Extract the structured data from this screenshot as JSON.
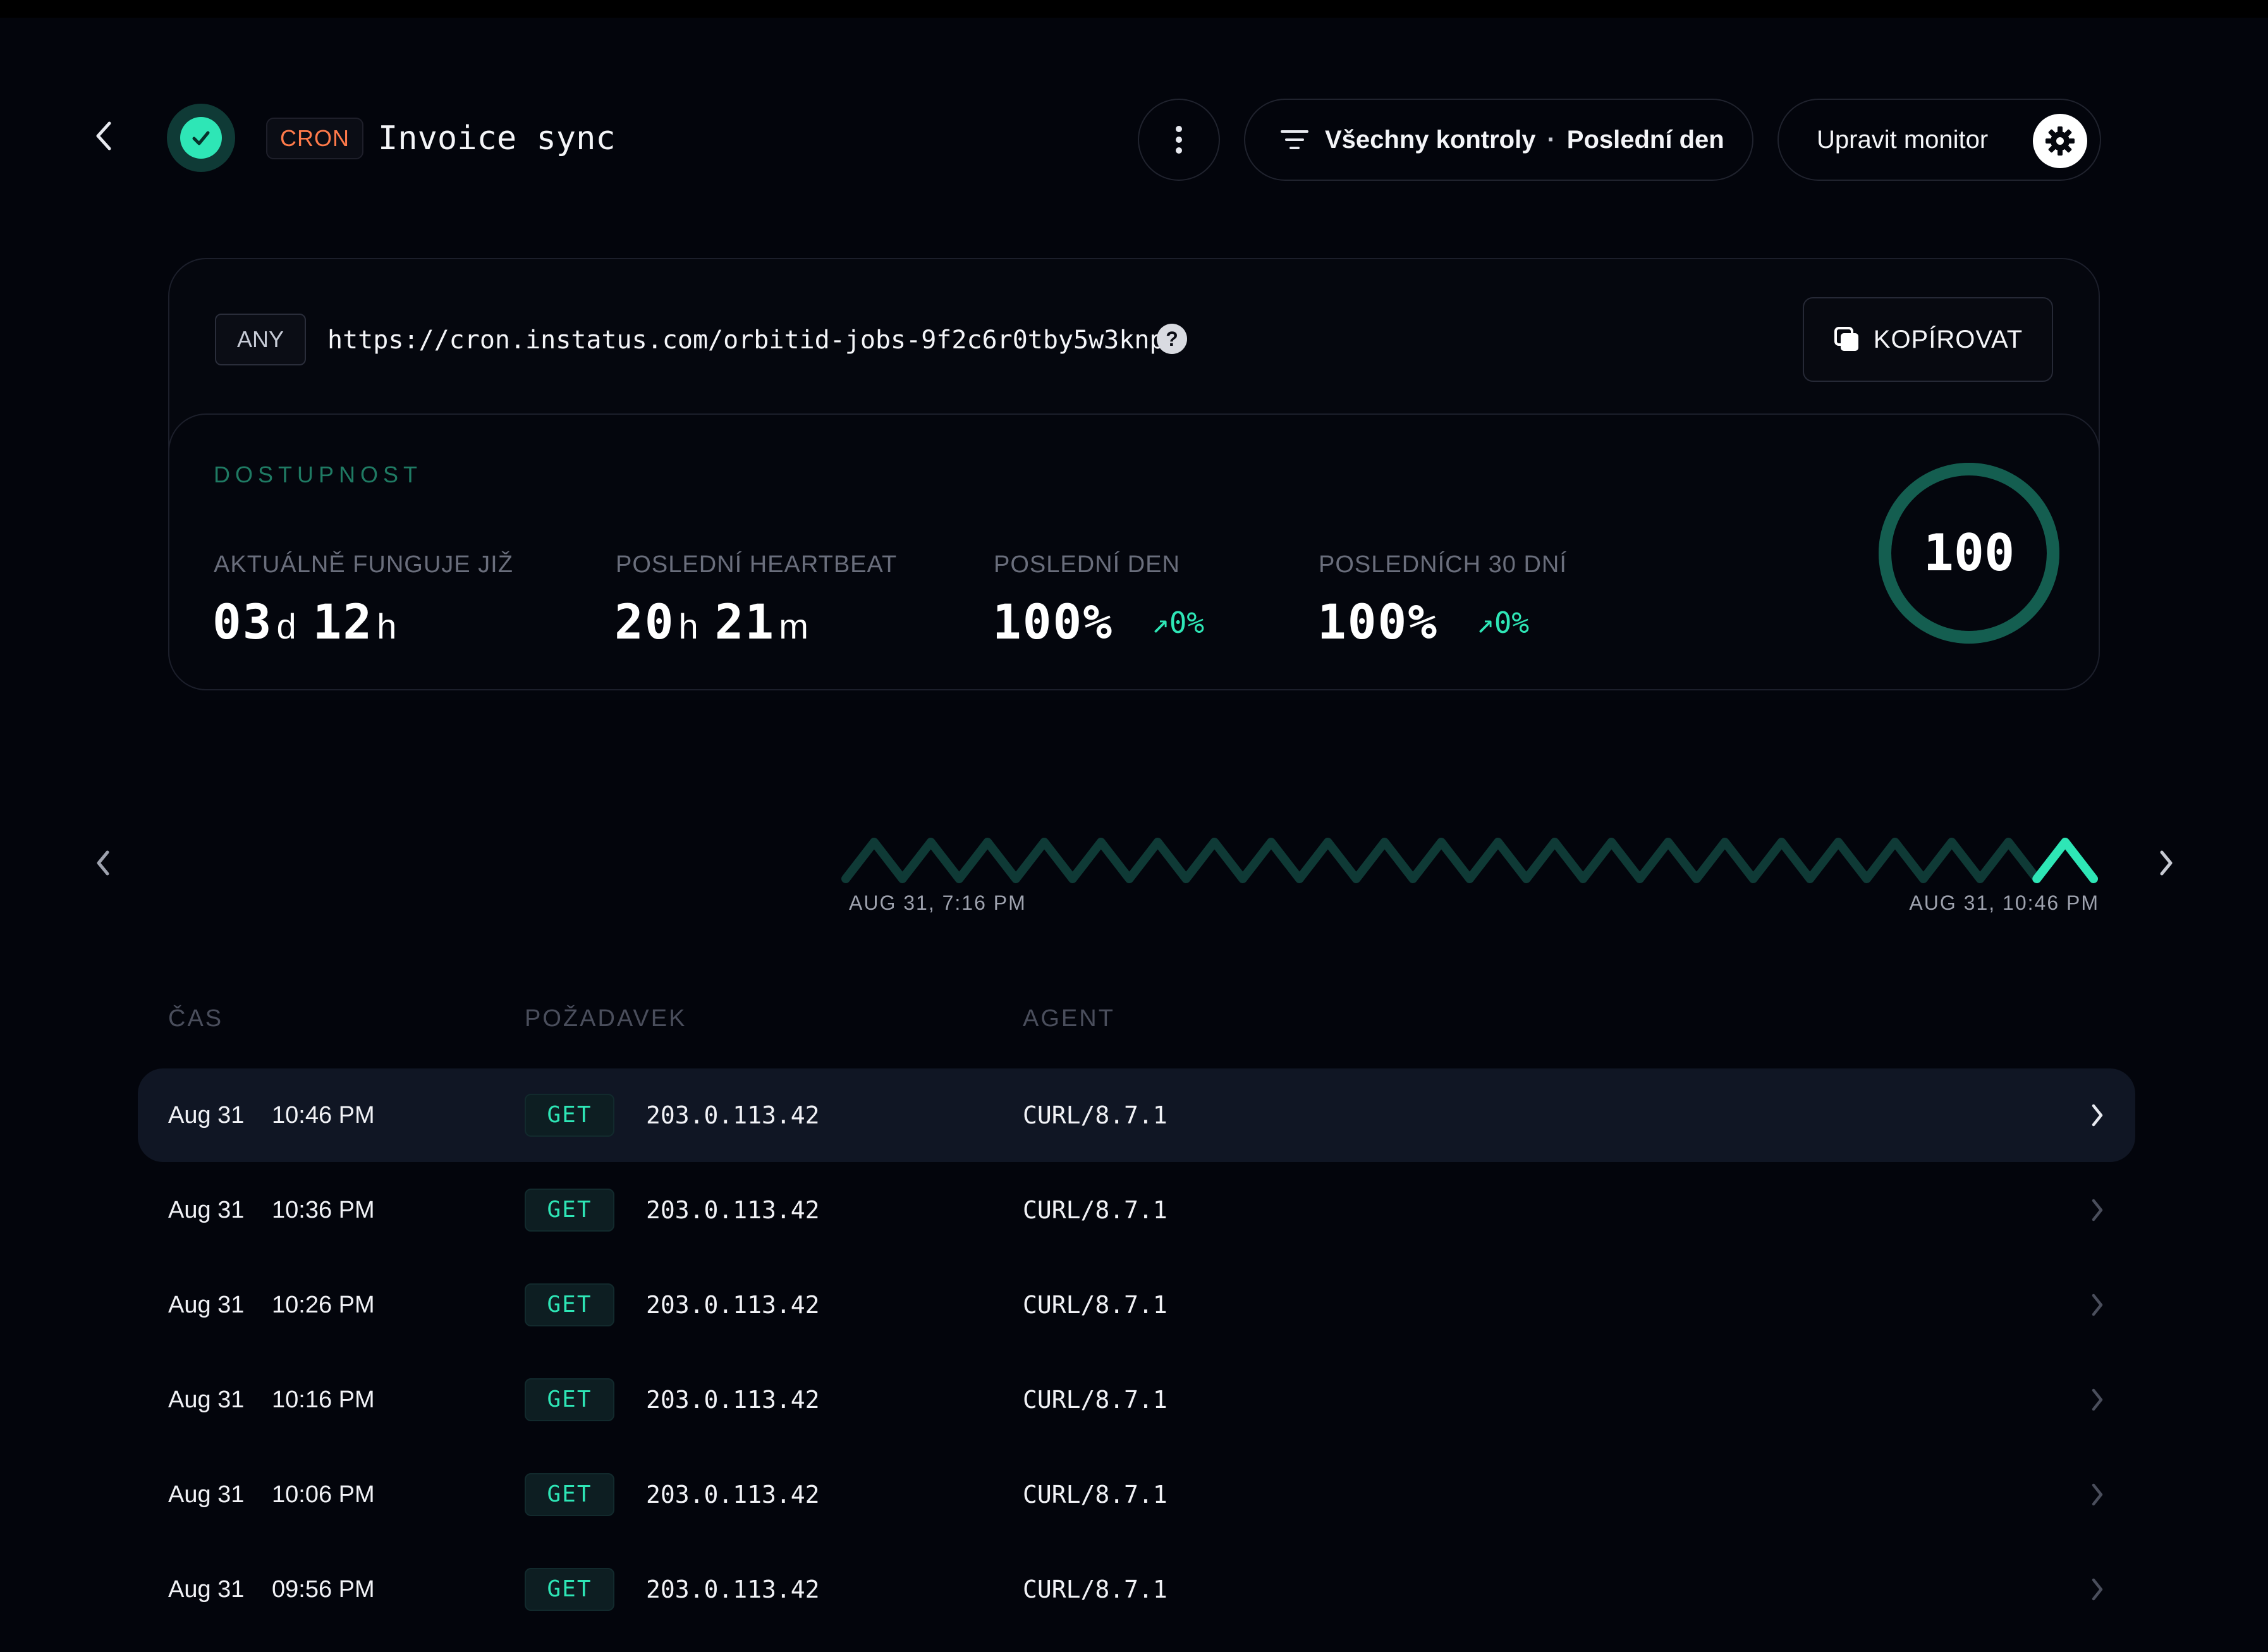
{
  "header": {
    "type_badge": "CRON",
    "title": "Invoice sync",
    "filter_label": "Všechny kontroly",
    "filter_separator": "·",
    "filter_period": "Poslední den",
    "edit_label": "Upravit monitor"
  },
  "endpoint": {
    "method": "ANY",
    "url": "https://cron.instatus.com/orbitid-jobs-9f2c6r0tby5w3knp",
    "help_glyph": "?",
    "copy_label": "KOPÍROVAT"
  },
  "availability": {
    "section_title": "DOSTUPNOST",
    "stats": [
      {
        "label": "AKTUÁLNĚ FUNGUJE JIŽ",
        "v1": "03",
        "u1": "d",
        "v2": "12",
        "u2": "h"
      },
      {
        "label": "POSLEDNÍ HEARTBEAT",
        "v1": "20",
        "u1": "h",
        "v2": "21",
        "u2": "m"
      },
      {
        "label": "POSLEDNÍ DEN",
        "value": "100%",
        "delta": "0%"
      },
      {
        "label": "POSLEDNÍCH 30 DNÍ",
        "value": "100%",
        "delta": "0%"
      }
    ],
    "score": "100",
    "score_fraction": 1.0,
    "accent_color": "#2ee6b6"
  },
  "timeline": {
    "start_label": "AUG 31, 7:16 PM",
    "end_label": "AUG 31, 10:46 PM",
    "peaks": 22,
    "highlight_last": true
  },
  "table": {
    "headers": {
      "time": "ČAS",
      "request": "POŽADAVEK",
      "agent": "AGENT"
    },
    "rows": [
      {
        "date": "Aug 31",
        "time": "10:46 PM",
        "method": "GET",
        "ip": "203.0.113.42",
        "agent": "CURL/8.7.1",
        "selected": true
      },
      {
        "date": "Aug 31",
        "time": "10:36 PM",
        "method": "GET",
        "ip": "203.0.113.42",
        "agent": "CURL/8.7.1",
        "selected": false
      },
      {
        "date": "Aug 31",
        "time": "10:26 PM",
        "method": "GET",
        "ip": "203.0.113.42",
        "agent": "CURL/8.7.1",
        "selected": false
      },
      {
        "date": "Aug 31",
        "time": "10:16 PM",
        "method": "GET",
        "ip": "203.0.113.42",
        "agent": "CURL/8.7.1",
        "selected": false
      },
      {
        "date": "Aug 31",
        "time": "10:06 PM",
        "method": "GET",
        "ip": "203.0.113.42",
        "agent": "CURL/8.7.1",
        "selected": false
      },
      {
        "date": "Aug 31",
        "time": "09:56 PM",
        "method": "GET",
        "ip": "203.0.113.42",
        "agent": "CURL/8.7.1",
        "selected": false
      }
    ]
  }
}
